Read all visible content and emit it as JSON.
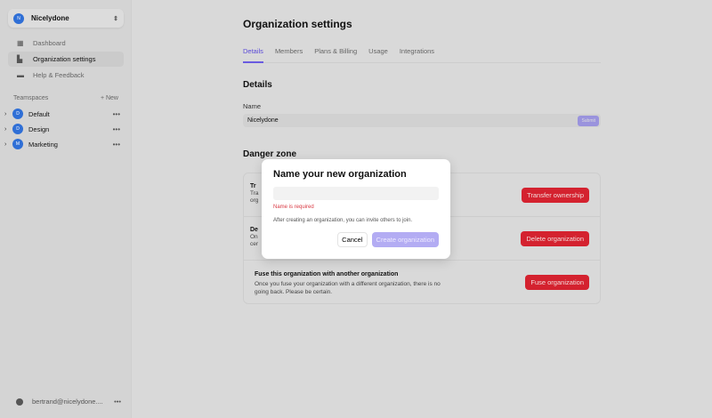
{
  "sidebar": {
    "org": {
      "initial": "N",
      "name": "Nicelydone"
    },
    "nav": [
      {
        "label": "Dashboard"
      },
      {
        "label": "Organization settings"
      },
      {
        "label": "Help & Feedback"
      }
    ],
    "teamspaces_label": "Teamspaces",
    "new_label": "New",
    "teamspaces": [
      {
        "initial": "D",
        "name": "Default"
      },
      {
        "initial": "D",
        "name": "Design"
      },
      {
        "initial": "M",
        "name": "Marketing"
      }
    ],
    "user_email": "bertrand@nicelydone...."
  },
  "main": {
    "title": "Organization settings",
    "tabs": [
      {
        "label": "Details"
      },
      {
        "label": "Members"
      },
      {
        "label": "Plans & Billing"
      },
      {
        "label": "Usage"
      },
      {
        "label": "Integrations"
      }
    ],
    "section": "Details",
    "name_label": "Name",
    "name_value": "Nicelydone",
    "submit_label": "Submit",
    "danger_title": "Danger zone",
    "rows": [
      {
        "title": "Tr",
        "desc": "Tra org",
        "button": "Transfer ownership"
      },
      {
        "title": "De",
        "desc": "On cer",
        "button": "Delete organization"
      },
      {
        "title": "Fuse this organization with another organization",
        "desc": "Once you fuse your organization with a different organization, there is no going back. Please be certain.",
        "button": "Fuse organization"
      }
    ]
  },
  "modal": {
    "title": "Name your new organization",
    "input_value": "",
    "error": "Name is required",
    "info": "After creating an organization, you can invite others to join.",
    "cancel": "Cancel",
    "create": "Create organization"
  }
}
